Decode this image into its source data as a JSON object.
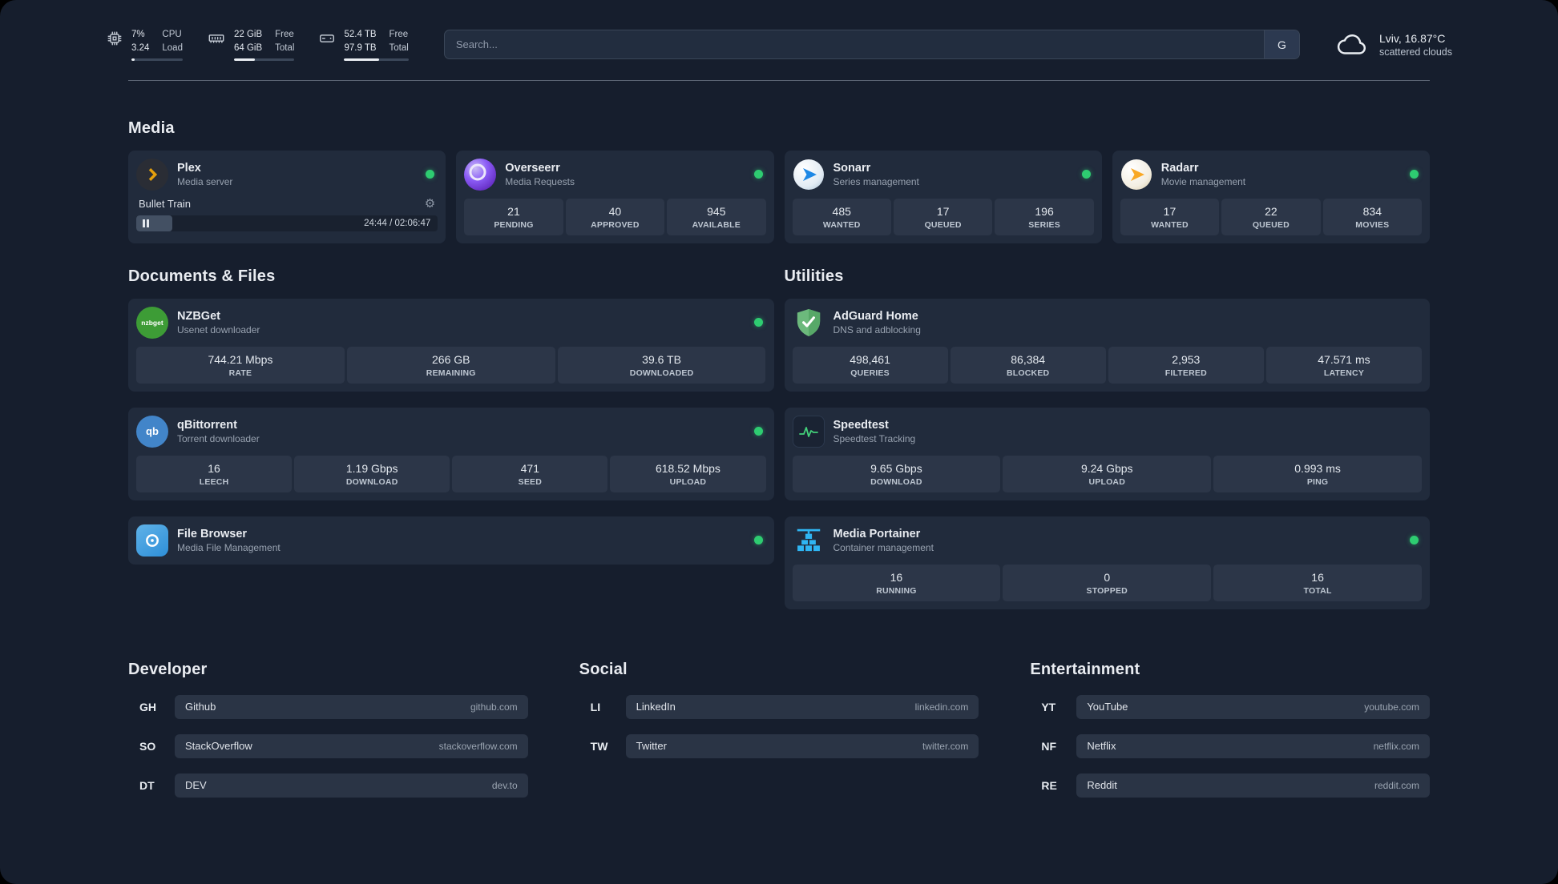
{
  "topbar": {
    "cpu": {
      "percent": "7%",
      "load": "3.24",
      "label_top": "CPU",
      "label_bottom": "Load",
      "progress": 7
    },
    "memory": {
      "free": "22 GiB",
      "total": "64 GiB",
      "label_top": "Free",
      "label_bottom": "Total",
      "progress": 35
    },
    "disk": {
      "free": "52.4 TB",
      "total": "97.9 TB",
      "label_top": "Free",
      "label_bottom": "Total",
      "progress": 54
    },
    "search": {
      "placeholder": "Search...",
      "button": "G"
    },
    "weather": {
      "location": "Lviv, 16.87°C",
      "condition": "scattered clouds"
    }
  },
  "sections": {
    "media": {
      "title": "Media"
    },
    "documents": {
      "title": "Documents & Files"
    },
    "utilities": {
      "title": "Utilities"
    }
  },
  "services": {
    "plex": {
      "name": "Plex",
      "subtitle": "Media server",
      "now_playing": "Bullet Train",
      "elapsed": "24:44 / 02:06:47",
      "progress": 12
    },
    "overseerr": {
      "name": "Overseerr",
      "subtitle": "Media Requests",
      "stats": [
        {
          "value": "21",
          "label": "PENDING"
        },
        {
          "value": "40",
          "label": "APPROVED"
        },
        {
          "value": "945",
          "label": "AVAILABLE"
        }
      ]
    },
    "sonarr": {
      "name": "Sonarr",
      "subtitle": "Series management",
      "stats": [
        {
          "value": "485",
          "label": "WANTED"
        },
        {
          "value": "17",
          "label": "QUEUED"
        },
        {
          "value": "196",
          "label": "SERIES"
        }
      ]
    },
    "radarr": {
      "name": "Radarr",
      "subtitle": "Movie management",
      "stats": [
        {
          "value": "17",
          "label": "WANTED"
        },
        {
          "value": "22",
          "label": "QUEUED"
        },
        {
          "value": "834",
          "label": "MOVIES"
        }
      ]
    },
    "nzbget": {
      "name": "NZBGet",
      "subtitle": "Usenet downloader",
      "icon_text": "nzbget",
      "stats": [
        {
          "value": "744.21 Mbps",
          "label": "RATE"
        },
        {
          "value": "266 GB",
          "label": "REMAINING"
        },
        {
          "value": "39.6 TB",
          "label": "DOWNLOADED"
        }
      ]
    },
    "qbittorrent": {
      "name": "qBittorrent",
      "subtitle": "Torrent downloader",
      "icon_text": "qb",
      "stats": [
        {
          "value": "16",
          "label": "LEECH"
        },
        {
          "value": "1.19 Gbps",
          "label": "DOWNLOAD"
        },
        {
          "value": "471",
          "label": "SEED"
        },
        {
          "value": "618.52 Mbps",
          "label": "UPLOAD"
        }
      ]
    },
    "filebrowser": {
      "name": "File Browser",
      "subtitle": "Media File Management"
    },
    "adguard": {
      "name": "AdGuard Home",
      "subtitle": "DNS and adblocking",
      "stats": [
        {
          "value": "498,461",
          "label": "QUERIES"
        },
        {
          "value": "86,384",
          "label": "BLOCKED"
        },
        {
          "value": "2,953",
          "label": "FILTERED"
        },
        {
          "value": "47.571 ms",
          "label": "LATENCY"
        }
      ]
    },
    "speedtest": {
      "name": "Speedtest",
      "subtitle": "Speedtest Tracking",
      "stats": [
        {
          "value": "9.65 Gbps",
          "label": "DOWNLOAD"
        },
        {
          "value": "9.24 Gbps",
          "label": "UPLOAD"
        },
        {
          "value": "0.993 ms",
          "label": "PING"
        }
      ]
    },
    "portainer": {
      "name": "Media Portainer",
      "subtitle": "Container management",
      "stats": [
        {
          "value": "16",
          "label": "RUNNING"
        },
        {
          "value": "0",
          "label": "STOPPED"
        },
        {
          "value": "16",
          "label": "TOTAL"
        }
      ]
    }
  },
  "bookmarks": {
    "developer": {
      "title": "Developer",
      "items": [
        {
          "abbr": "GH",
          "name": "Github",
          "url": "github.com"
        },
        {
          "abbr": "SO",
          "name": "StackOverflow",
          "url": "stackoverflow.com"
        },
        {
          "abbr": "DT",
          "name": "DEV",
          "url": "dev.to"
        }
      ]
    },
    "social": {
      "title": "Social",
      "items": [
        {
          "abbr": "LI",
          "name": "LinkedIn",
          "url": "linkedin.com"
        },
        {
          "abbr": "TW",
          "name": "Twitter",
          "url": "twitter.com"
        }
      ]
    },
    "entertainment": {
      "title": "Entertainment",
      "items": [
        {
          "abbr": "YT",
          "name": "YouTube",
          "url": "youtube.com"
        },
        {
          "abbr": "NF",
          "name": "Netflix",
          "url": "netflix.com"
        },
        {
          "abbr": "RE",
          "name": "Reddit",
          "url": "reddit.com"
        }
      ]
    }
  },
  "colors": {
    "status_online": "#2ecc71",
    "accent_plex": "#e5a00d",
    "background": "#161e2d"
  }
}
